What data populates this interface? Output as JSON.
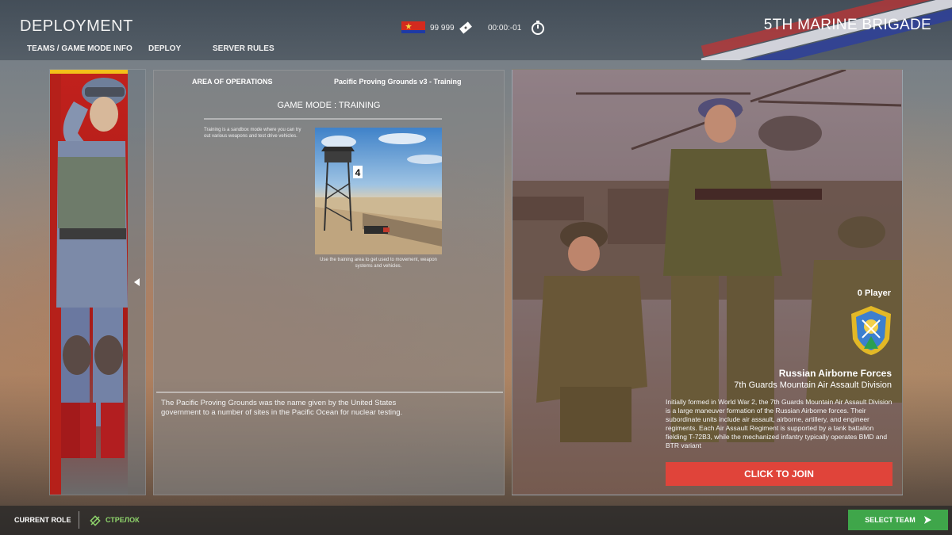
{
  "header": {
    "title": "DEPLOYMENT",
    "tabs": [
      {
        "label": "TEAMS / GAME MODE INFO"
      },
      {
        "label": "DEPLOY"
      },
      {
        "label": "SERVER RULES"
      }
    ],
    "tickets": "99 999",
    "timer": "00:00:-01",
    "brigade_name": "5TH MARINE BRIGADE",
    "icons": {
      "ticket": "ticket-icon",
      "timer": "stopwatch-icon",
      "flag": "faction-flag-icon"
    }
  },
  "game_mode": {
    "area_label": "AREA OF OPERATIONS",
    "map_name": "Pacific Proving Grounds v3 - Training",
    "mode_title": "GAME MODE : TRAINING",
    "description": "Training is a sandbox mode where you can try out various weapons and test drive vehicles.",
    "image_caption": "Use the training area to get used to movement, weapon systems and vehicles.",
    "map_description": "The Pacific Proving Grounds was the name given by the United States government to a number of sites in the Pacific Ocean for nuclear testing."
  },
  "team": {
    "player_count": "0 Player",
    "faction_name": "Russian Airborne Forces",
    "division_name": "7th Guards Mountain Air Assault Division",
    "description": "Initially formed in World War 2, the 7th Guards Mountain Air Assault Division is a large maneuver formation of the Russian Airborne forces. Their subordinate units include air assault, airborne, artillery, and engineer regiments. Each Air Assault Regiment is supported by a tank battalion fielding T-72B3, while the mechanized infantry typically operates BMD and BTR variant",
    "join_label": "CLICK TO JOIN"
  },
  "footer": {
    "current_role_label": "CURRENT ROLE",
    "role_name": "СТРЕЛОК",
    "select_team_label": "SELECT TEAM"
  },
  "colors": {
    "join_button": "#e0443a",
    "select_team_button": "#3fa64a",
    "role_text": "#8ed36b"
  }
}
